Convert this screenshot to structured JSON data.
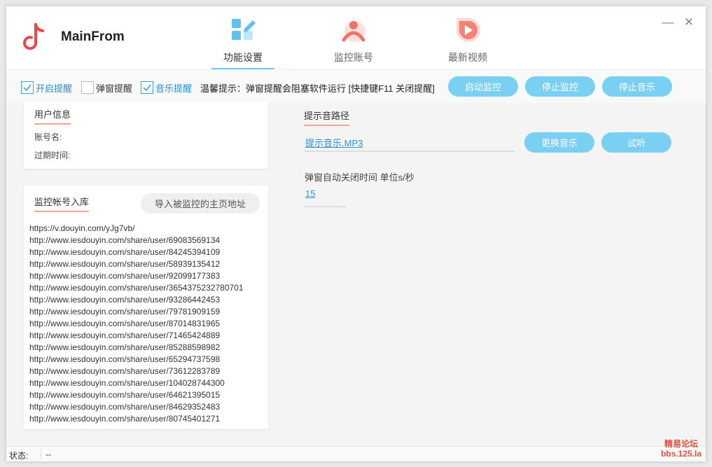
{
  "app": {
    "title": "MainFrom"
  },
  "tabs": [
    {
      "label": "功能设置",
      "icon": "settings-grid-icon",
      "active": true
    },
    {
      "label": "监控账号",
      "icon": "user-account-icon",
      "active": false
    },
    {
      "label": "最新视频",
      "icon": "play-video-icon",
      "active": false
    }
  ],
  "window_controls": {
    "minimize": "—",
    "close": "✕"
  },
  "toolbar": {
    "checkboxes": [
      {
        "label": "开启提醒",
        "checked": true
      },
      {
        "label": "弹窗提醒",
        "checked": false
      },
      {
        "label": "音乐提醒",
        "checked": true
      }
    ],
    "hint": "温馨提示：弹窗提醒会阻塞软件运行 [快捷键F11 关闭提醒]",
    "buttons": {
      "start": "启动监控",
      "stop": "停止监控",
      "stop_music": "停止音乐"
    }
  },
  "user_info": {
    "title": "用户信息",
    "account_label": "账号名:",
    "expire_label": "过期时间:"
  },
  "monitor": {
    "title": "监控帐号入库",
    "import_button": "导入被监控的主页地址",
    "urls": [
      "https://v.douyin.com/yJg7vb/",
      "http://www.iesdouyin.com/share/user/69083569134",
      "http://www.iesdouyin.com/share/user/84245394109",
      "http://www.iesdouyin.com/share/user/58939135412",
      "http://www.iesdouyin.com/share/user/92099177383",
      "http://www.iesdouyin.com/share/user/3654375232780701",
      "http://www.iesdouyin.com/share/user/93286442453",
      "http://www.iesdouyin.com/share/user/79781909159",
      "http://www.iesdouyin.com/share/user/87014831965",
      "http://www.iesdouyin.com/share/user/71465424889",
      "http://www.iesdouyin.com/share/user/85288598982",
      "http://www.iesdouyin.com/share/user/65294737598",
      "http://www.iesdouyin.com/share/user/73612283789",
      "http://www.iesdouyin.com/share/user/104028744300",
      "http://www.iesdouyin.com/share/user/64621395015",
      "http://www.iesdouyin.com/share/user/84629352483",
      "http://www.iesdouyin.com/share/user/80745401271"
    ]
  },
  "sound": {
    "title": "提示音路径",
    "path": "提示音乐.MP3",
    "change_button": "更换音乐",
    "preview_button": "试听"
  },
  "popup": {
    "label": "弹窗自动关闭时间 单位s/秒",
    "value": "15"
  },
  "status": {
    "label": "状态:",
    "value": "--"
  },
  "watermark": {
    "line1": "精易论坛",
    "line2": "bbs.125.la"
  },
  "colors": {
    "accent": "#79d0f2",
    "link": "#2f8fd0",
    "title_underline": "#f3a49a",
    "logo": "#e8474c"
  }
}
